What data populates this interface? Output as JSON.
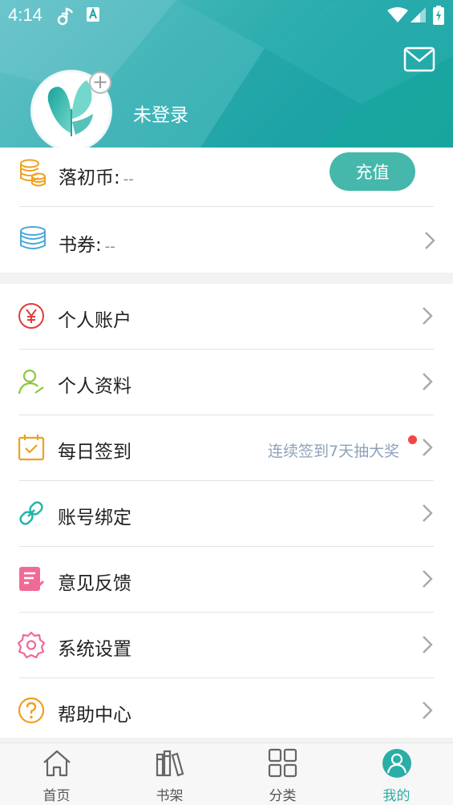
{
  "status_bar": {
    "time": "4:14"
  },
  "header": {
    "login_text": "未登录",
    "icons": [
      "mail-icon",
      "butterfly-avatar-icon",
      "plus-icon"
    ]
  },
  "coins": {
    "luochu_label": "落初币:",
    "luochu_value": "--",
    "recharge_label": "充值",
    "voucher_label": "书券:",
    "voucher_value": "--"
  },
  "menu": {
    "items": [
      {
        "label": "个人账户",
        "icon": "yen-icon"
      },
      {
        "label": "个人资料",
        "icon": "user-icon"
      },
      {
        "label": "每日签到",
        "icon": "calendar-check-icon",
        "hint": "连续签到7天抽大奖"
      },
      {
        "label": "账号绑定",
        "icon": "link-icon"
      },
      {
        "label": "意见反馈",
        "icon": "feedback-icon"
      },
      {
        "label": "系统设置",
        "icon": "gear-icon"
      },
      {
        "label": "帮助中心",
        "icon": "help-icon"
      }
    ]
  },
  "bottom_nav": {
    "items": [
      {
        "label": "首页",
        "icon": "home-icon"
      },
      {
        "label": "书架",
        "icon": "bookshelf-icon"
      },
      {
        "label": "分类",
        "icon": "grid-icon"
      },
      {
        "label": "我的",
        "icon": "profile-icon",
        "active": true
      }
    ]
  },
  "colors": {
    "accent": "#2aaea6",
    "header": "#1fa7a7",
    "recharge": "#45b8ab",
    "hint": "#8fa3b8",
    "dot": "#f04646"
  }
}
